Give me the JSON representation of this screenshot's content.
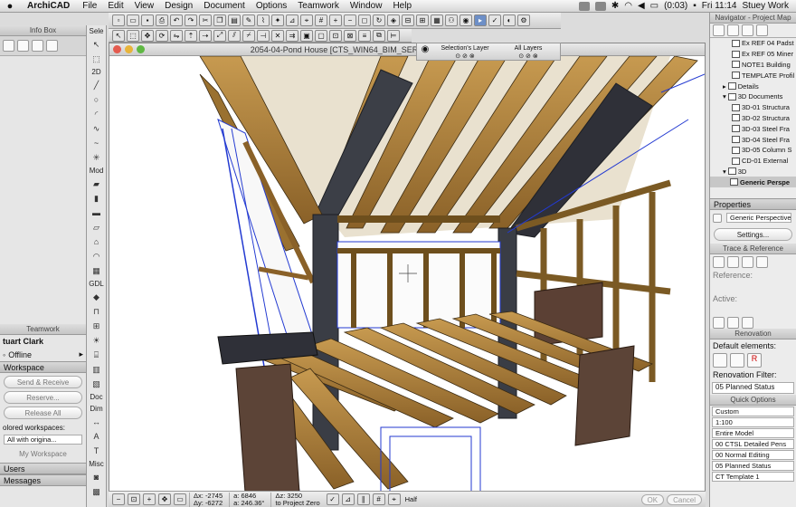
{
  "menubar": {
    "app_name": "ArchiCAD",
    "menus": [
      "File",
      "Edit",
      "View",
      "Design",
      "Document",
      "Options",
      "Teamwork",
      "Window",
      "Help"
    ],
    "battery": "(0:03)",
    "clock": "Fri 11:14",
    "user": "Stuey Work"
  },
  "info_box": {
    "title": "Info Box",
    "select_label": "Sele"
  },
  "toolbox": {
    "sections": {
      "design": "2D",
      "model": "Mod",
      "gdl": "GDL",
      "doc": "Doc",
      "dim": "Dim",
      "misc": "Misc"
    }
  },
  "teamwork": {
    "title": "Teamwork",
    "user_name": "tuart Clark",
    "status": "Offline",
    "workspace_label": "Workspace",
    "send_receive": "Send & Receive",
    "reserve": "Reserve...",
    "release_all": "Release All",
    "colored_workspaces_label": "olored workspaces:",
    "colored_workspaces_value": "All with origina...",
    "my_workspace": "My Workspace",
    "users_label": "Users",
    "messages_label": "Messages"
  },
  "window": {
    "title": "2054-04-Pond House  [CTS_WIN64_BIM_SER"
  },
  "layer_bar": {
    "selections_layer": "Selection's Layer",
    "all_layers": "All Layers"
  },
  "status": {
    "dx_label": "Δx:",
    "dx": "-2745",
    "dy_label": "Δy:",
    "dy": "-6272",
    "ax_label": "a:",
    "ax": "6846",
    "ang_label": "a:",
    "ang": "246.36°",
    "z_label": "Δz:",
    "z": "3250",
    "z_ref": "to Project Zero",
    "half": "Half",
    "ok": "OK",
    "cancel": "Cancel"
  },
  "navigator": {
    "title": "Navigator - Project Map",
    "items": [
      {
        "label": "Ex REF 04 Padst",
        "level": "sub"
      },
      {
        "label": "Ex REF 05 Miner",
        "level": "sub"
      },
      {
        "label": "NOTE1 Building",
        "level": "sub"
      },
      {
        "label": "TEMPLATE Profil",
        "level": "sub"
      },
      {
        "label": "Details",
        "level": "top"
      },
      {
        "label": "3D Documents",
        "level": "top"
      },
      {
        "label": "3D-01 Structura",
        "level": "sub"
      },
      {
        "label": "3D-02 Structura",
        "level": "sub"
      },
      {
        "label": "3D-03 Steel Fra",
        "level": "sub"
      },
      {
        "label": "3D-04 Steel Fra",
        "level": "sub"
      },
      {
        "label": "3D-05 Column S",
        "level": "sub"
      },
      {
        "label": "CD-01 External",
        "level": "sub"
      },
      {
        "label": "3D",
        "level": "top"
      },
      {
        "label": "Generic Perspe",
        "level": "sel"
      }
    ],
    "properties_title": "Properties",
    "properties_value": "Generic Perspective",
    "settings_button": "Settings...",
    "trace_title": "Trace & Reference",
    "reference_label": "Reference:",
    "active_label": "Active:",
    "renovation_title": "Renovation",
    "default_elements_label": "Default elements:",
    "renovation_filter_label": "Renovation Filter:",
    "renovation_filter_value": "05 Planned Status",
    "quick_options_title": "Quick Options",
    "quick_options": [
      "Custom",
      "1:100",
      "Entire Model",
      "00 CTSL Detailed Pens",
      "00 Normal Editing",
      "05 Planned Status",
      "CT Template 1"
    ]
  }
}
